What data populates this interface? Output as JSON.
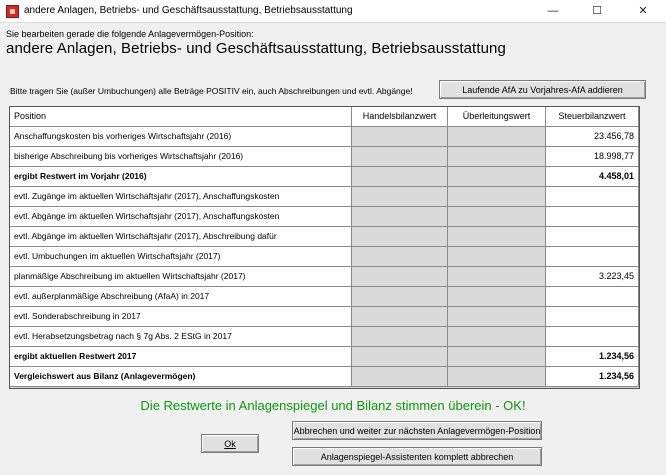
{
  "window": {
    "title": "andere Anlagen, Betriebs- und Geschäftsausstattung, Betriebsausstattung",
    "icon": "app-icon",
    "minimize_glyph": "—",
    "maximize_glyph": "☐",
    "close_glyph": "✕"
  },
  "header": {
    "sub_label": "Sie bearbeiten gerade die folgende Anlagevermögen-Position:",
    "heading": "andere Anlagen, Betriebs- und Geschäftsausstattung, Betriebsausstattung"
  },
  "instructions": "Bitte tragen Sie (außer Umbuchungen) alle Beträge POSITIV ein, auch Abschreibungen und evtl. Abgänge!",
  "buttons": {
    "afa_label": "Laufende AfA zu Vorjahres-AfA addieren",
    "ok_label": "Ok",
    "next_label": "Abbrechen und weiter zur nächsten Anlagevermögen-Position",
    "abort_label": "Anlagenspiegel-Assistenten komplett abbrechen"
  },
  "table": {
    "columns": [
      "Position",
      "Handelsbilanzwert",
      "Überleitungswert",
      "Steuerbilanzwert"
    ],
    "rows": [
      {
        "label": "Anschaffungskosten bis vorheriges Wirtschaftsjahr (2016)",
        "steuer": "23.456,78"
      },
      {
        "label": "bisherige Abschreibung bis vorheriges Wirtschaftsjahr (2016)",
        "steuer": "18.998,77"
      },
      {
        "label": "ergibt Restwert im Vorjahr (2016)",
        "steuer": "4.458,01"
      },
      {
        "label": "evtl. Zugänge im aktuellen Wirtschaftsjahr (2017), Anschaffungskosten",
        "steuer": ""
      },
      {
        "label": "evtl. Abgänge im aktuellen Wirtschaftsjahr (2017), Anschaffungskosten",
        "steuer": ""
      },
      {
        "label": "evtl. Abgänge im aktuellen Wirtschaftsjahr (2017), Abschreibung dafür",
        "steuer": ""
      },
      {
        "label": "evtl. Umbuchungen im aktuellen Wirtschaftsjahr (2017)",
        "steuer": ""
      },
      {
        "label": "planmäßige Abschreibung im aktuellen Wirtschaftsjahr (2017)",
        "steuer": "3.223,45"
      },
      {
        "label": "evtl. außerplanmäßige Abschreibung (AfaA) in 2017",
        "steuer": ""
      },
      {
        "label": "evtl. Sonderabschreibung in 2017",
        "steuer": ""
      },
      {
        "label": "evtl. Herabsetzungsbetrag nach § 7g Abs. 2 EStG in 2017",
        "steuer": ""
      },
      {
        "label": "ergibt aktuellen Restwert 2017",
        "steuer": "1.234,56"
      },
      {
        "label": "Vergleichswert aus Bilanz (Anlagevermögen)",
        "steuer": "1.234,56"
      }
    ]
  },
  "status_message": "Die Restwerte in Anlagenspiegel und Bilanz stimmen überein - OK!",
  "colors": {
    "status": "#0a9a0a",
    "app_icon": "#d42a1c"
  }
}
